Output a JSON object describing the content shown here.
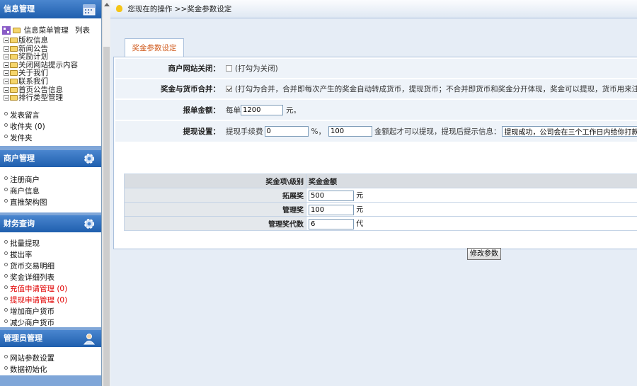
{
  "sidebar": {
    "sections": {
      "info": {
        "title": "信息管理",
        "tree_root": {
          "label": "信息菜单管理",
          "action": "列表"
        },
        "tree_items": [
          "版权信息",
          "新闻公告",
          "奖励计划",
          "关闭网站提示内容",
          "关于我们",
          "联系我们",
          "首页公告信息",
          "排行类型管理"
        ],
        "links": [
          "发表留言",
          "收件夹 (0)",
          "发件夹"
        ]
      },
      "merchant": {
        "title": "商户管理",
        "links": [
          "注册商户",
          "商户信息",
          "直推架构图"
        ]
      },
      "finance": {
        "title": "财务查询",
        "links": [
          "批量提现",
          "拔出率",
          "货币交易明细",
          "奖金详细列表",
          "充值申请管理 (0)",
          "提现申请管理 (0)",
          "增加商户货币",
          "减少商户货币"
        ]
      },
      "admin": {
        "title": "管理员管理",
        "links": [
          "网站参数设置",
          "数据初始化"
        ]
      }
    }
  },
  "topbar": {
    "breadcrumb": "您现在的操作 >>奖金参数设定"
  },
  "tab": {
    "label": "奖金参数设定"
  },
  "form": {
    "close_site": {
      "label": "商户网站关闭：",
      "checked": false,
      "hint": "(打勾为关闭)"
    },
    "merge": {
      "label": "奖金与货币合并：",
      "checked": true,
      "hint": "(打勾为合并，合并即每次产生的奖金自动转成货币，提现货币；不合并即货币和奖金分开体现，奖金可以提现，货币用来注册商户或者"
    },
    "report_amount": {
      "label": "报单金额：",
      "prefix": "每单",
      "value": "1200",
      "suffix": "元。"
    },
    "withdraw": {
      "label": "提现设置：",
      "fee_label": "提现手续费",
      "fee_value": "0",
      "percent": "%，",
      "min_value": "100",
      "min_text": "金额起才可以提现，提现后提示信息：",
      "message_value": "提现成功，公司会在三个工作日内给你打款"
    }
  },
  "bonus_table": {
    "header": {
      "level": "奖金项\\级别",
      "amount": "奖金金额"
    },
    "rows": [
      {
        "name": "拓展奖",
        "value": "500",
        "unit": "元"
      },
      {
        "name": "管理奖",
        "value": "100",
        "unit": "元"
      },
      {
        "name": "管理奖代数",
        "value": "6",
        "unit": "代"
      }
    ]
  },
  "submit": {
    "label": "修改参数"
  }
}
